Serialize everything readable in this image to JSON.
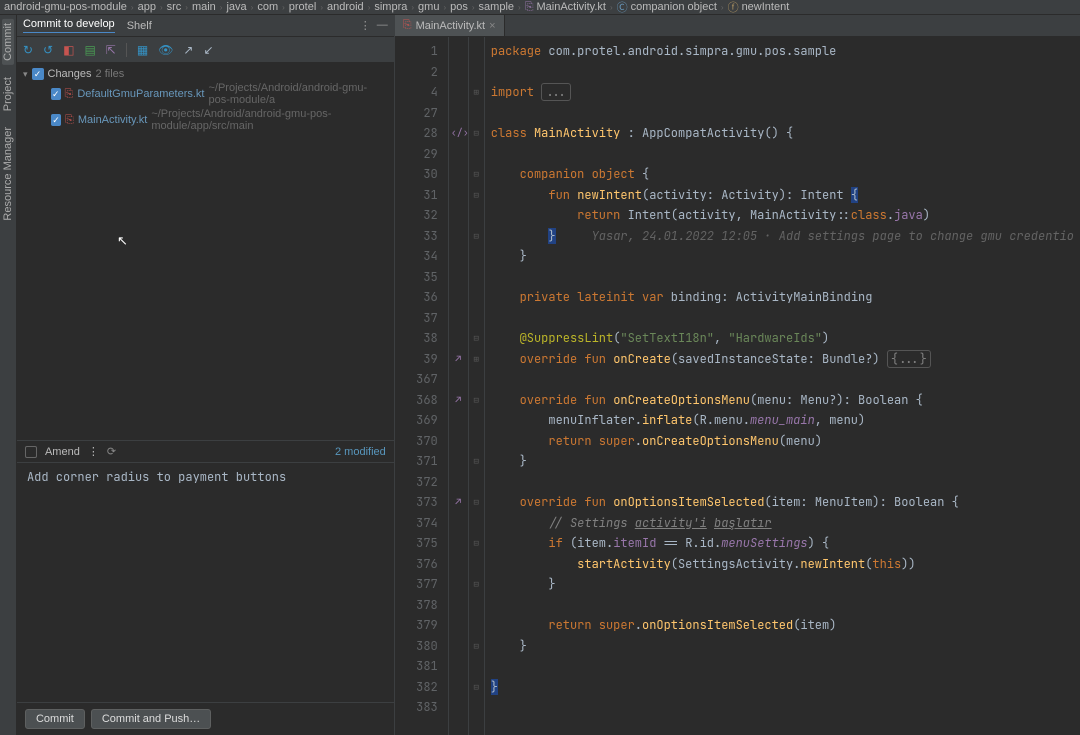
{
  "breadcrumb": {
    "items": [
      "android-gmu-pos-module",
      "app",
      "src",
      "main",
      "java",
      "com",
      "protel",
      "android",
      "simpra",
      "gmu",
      "pos",
      "sample"
    ],
    "file": "MainActivity.kt",
    "class": "companion object",
    "method": "newIntent"
  },
  "left_rail": {
    "commit": "Commit",
    "project": "Project",
    "resource_manager": "Resource Manager"
  },
  "commit_panel": {
    "tab_commit": "Commit to develop",
    "tab_shelf": "Shelf",
    "changes_label": "Changes",
    "changes_count": "2 files",
    "files": [
      {
        "name": "DefaultGmuParameters.kt",
        "path": "~/Projects/Android/android-gmu-pos-module/a"
      },
      {
        "name": "MainActivity.kt",
        "path": "~/Projects/Android/android-gmu-pos-module/app/src/main"
      }
    ],
    "amend": "Amend",
    "modified": "2 modified",
    "commit_message": "Add corner radius to payment buttons",
    "btn_commit": "Commit",
    "btn_commit_push": "Commit and Push…"
  },
  "editor": {
    "tab_name": "MainActivity.kt",
    "lines": [
      {
        "n": "1",
        "t": "package",
        "code": "<span class='kw'>package</span> <span class='pkg'>com.protel.android.simpra.gmu.pos.sample</span>"
      },
      {
        "n": "2",
        "t": "",
        "code": ""
      },
      {
        "n": "4",
        "t": "import",
        "code": "<span class='kw'>import</span> <span class='fold-dots'>...</span>",
        "fold": "⊞"
      },
      {
        "n": "27",
        "t": "",
        "code": ""
      },
      {
        "n": "28",
        "t": "class",
        "code": "<span class='kw'>class</span> <span class='cname'>MainActivity</span> : <span class='typ'>AppCompatActivity</span>() {",
        "icon": "‹/›",
        "fold": "⊟"
      },
      {
        "n": "29",
        "t": "",
        "code": ""
      },
      {
        "n": "30",
        "t": "",
        "code": "    <span class='kw'>companion</span> <span class='kw'>object</span> {",
        "fold": "⊟"
      },
      {
        "n": "31",
        "t": "",
        "code": "        <span class='kw'>fun</span> <span class='fn'>newIntent</span>(activity: <span class='typ'>Activity</span>): <span class='typ'>Intent</span> <span class='hl'>{</span>",
        "fold": "⊟"
      },
      {
        "n": "32",
        "t": "",
        "code": "            <span class='kw'>return</span> <span class='typ'>Intent</span>(activity, MainActivity::<span class='kw'>class</span>.<span style='color:#9876aa'>java</span>)"
      },
      {
        "n": "33",
        "t": "blame",
        "code": "        <span class='hl'>}</span>     <span class='blame'>Yasar, 24.01.2022 12:05 · Add settings page to change gmu credentio</span>",
        "fold": "⊟"
      },
      {
        "n": "34",
        "t": "",
        "code": "    }"
      },
      {
        "n": "35",
        "t": "",
        "code": ""
      },
      {
        "n": "36",
        "t": "",
        "code": "    <span class='kw'>private</span> <span class='kw'>lateinit</span> <span class='kw'>var</span> binding: <span class='typ'>ActivityMainBinding</span>"
      },
      {
        "n": "37",
        "t": "",
        "code": ""
      },
      {
        "n": "38",
        "t": "",
        "code": "    <span class='anno'>@SuppressLint</span>(<span class='str'>\"SetTextI18n\"</span>, <span class='str'>\"HardwareIds\"</span>)",
        "fold": "⊟"
      },
      {
        "n": "39",
        "t": "",
        "code": "    <span class='kw'>override</span> <span class='kw'>fun</span> <span class='fn'>onCreate</span>(savedInstanceState: <span class='typ'>Bundle</span>?) <span class='fold-dots'>{...}</span>",
        "icon": "↗",
        "fold": "⊞"
      },
      {
        "n": "367",
        "t": "",
        "code": ""
      },
      {
        "n": "368",
        "t": "",
        "code": "    <span class='kw'>override</span> <span class='kw'>fun</span> <span class='fn'>onCreateOptionsMenu</span>(menu: <span class='typ'>Menu</span>?): <span class='typ'>Boolean</span> {",
        "icon": "↗",
        "fold": "⊟"
      },
      {
        "n": "369",
        "t": "",
        "code": "        menuInflater.<span class='fn'>inflate</span>(R.menu.<span style='color:#9876aa;font-style:italic'>menu_main</span>, menu)"
      },
      {
        "n": "370",
        "t": "",
        "code": "        <span class='kw'>return</span> <span class='kw'>super</span>.<span class='fn'>onCreateOptionsMenu</span>(menu)"
      },
      {
        "n": "371",
        "t": "",
        "code": "    }",
        "fold": "⊟"
      },
      {
        "n": "372",
        "t": "",
        "code": ""
      },
      {
        "n": "373",
        "t": "",
        "code": "    <span class='kw'>override</span> <span class='kw'>fun</span> <span class='fn'>onOptionsItemSelected</span>(item: <span class='typ'>MenuItem</span>): <span class='typ'>Boolean</span> {",
        "icon": "↗",
        "fold": "⊟"
      },
      {
        "n": "374",
        "t": "",
        "code": "        <span class='cmt'>// Settings <u>activity'i</u> <u>başlatır</u></span>"
      },
      {
        "n": "375",
        "t": "",
        "code": "        <span class='kw'>if</span> (item.<span style='color:#9876aa'>itemId</span> == R.id.<span style='color:#9876aa;font-style:italic'>menuSettings</span>) {",
        "fold": "⊟"
      },
      {
        "n": "376",
        "t": "",
        "code": "            <span class='fn'>startActivity</span>(SettingsActivity.<span class='fn'>newIntent</span>(<span class='kw'>this</span>))"
      },
      {
        "n": "377",
        "t": "",
        "code": "        }",
        "fold": "⊟"
      },
      {
        "n": "378",
        "t": "",
        "code": ""
      },
      {
        "n": "379",
        "t": "",
        "code": "        <span class='kw'>return</span> <span class='kw'>super</span>.<span class='fn'>onOptionsItemSelected</span>(item)"
      },
      {
        "n": "380",
        "t": "",
        "code": "    }",
        "fold": "⊟"
      },
      {
        "n": "381",
        "t": "",
        "code": ""
      },
      {
        "n": "382",
        "t": "",
        "code": "<span class='hl'>}</span>",
        "fold": "⊟"
      },
      {
        "n": "383",
        "t": "",
        "code": ""
      }
    ]
  }
}
